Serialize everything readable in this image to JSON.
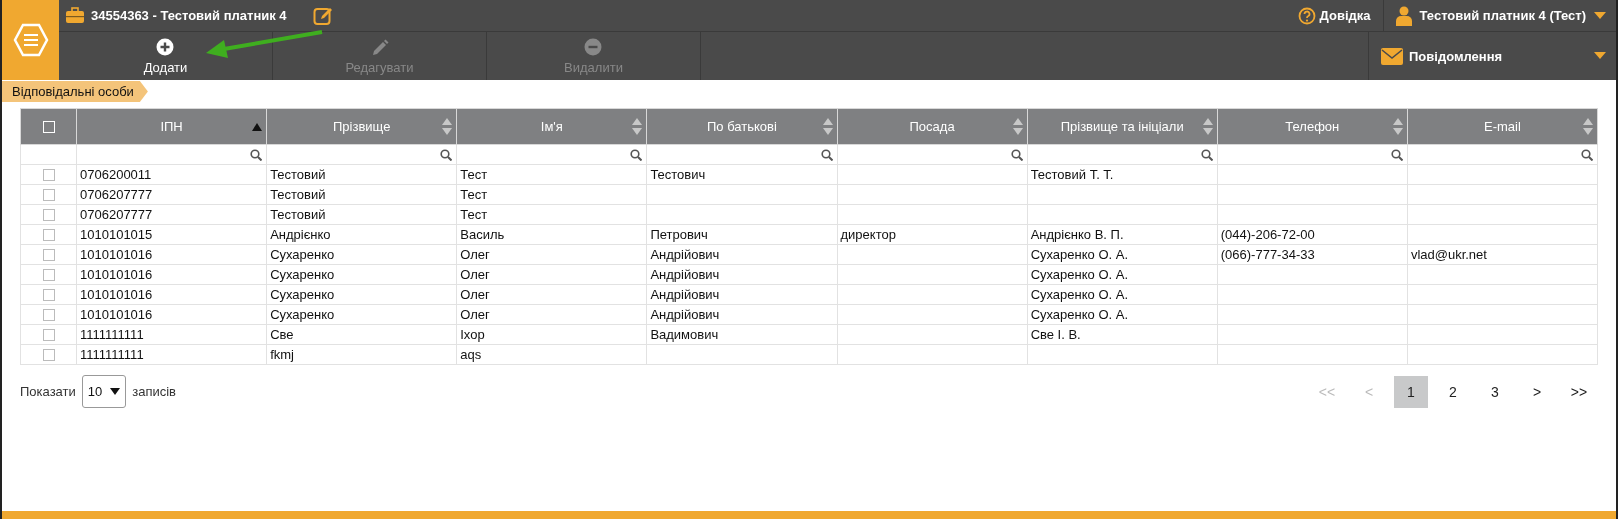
{
  "header": {
    "taxpayer": "34554363 - Тестовий платник 4",
    "help": "Довідка",
    "user": "Тестовий платник 4 (Тест)",
    "messages": "Повідомлення"
  },
  "toolbar": [
    {
      "kind": "add",
      "label": "Додати",
      "disabled": false
    },
    {
      "kind": "edit",
      "label": "Редагувати",
      "disabled": true
    },
    {
      "kind": "delete",
      "label": "Видалити",
      "disabled": true
    }
  ],
  "breadcrumb": "Відповідальні особи",
  "table": {
    "all_checked": false,
    "columns": [
      {
        "label": "ІПН",
        "sorted": true
      },
      {
        "label": "Прізвище",
        "sorted": false
      },
      {
        "label": "Ім'я",
        "sorted": false
      },
      {
        "label": "По батькові",
        "sorted": false
      },
      {
        "label": "Посада",
        "sorted": false
      },
      {
        "label": "Прізвище та ініціали",
        "sorted": false
      },
      {
        "label": "Телефон",
        "sorted": false
      },
      {
        "label": "E-mail",
        "sorted": false
      }
    ],
    "rows": [
      {
        "checked": false,
        "cells": [
          "0706200011",
          "Тестовий",
          "Тест",
          "Тестович",
          "",
          "Тестовий Т. Т.",
          "",
          ""
        ]
      },
      {
        "checked": false,
        "cells": [
          "0706207777",
          "Тестовий",
          "Тест",
          "",
          "",
          "",
          "",
          ""
        ]
      },
      {
        "checked": false,
        "cells": [
          "0706207777",
          "Тестовий",
          "Тест",
          "",
          "",
          "",
          "",
          ""
        ]
      },
      {
        "checked": false,
        "cells": [
          "1010101015",
          "Андрієнко",
          "Василь",
          "Петрович",
          "директор",
          "Андрієнко В. П.",
          "(044)-206-72-00",
          ""
        ]
      },
      {
        "checked": false,
        "cells": [
          "1010101016",
          "Сухаренко",
          "Олег",
          "Андрійович",
          "",
          "Сухаренко О. А.",
          "(066)-777-34-33",
          "vlad@ukr.net"
        ]
      },
      {
        "checked": false,
        "cells": [
          "1010101016",
          "Сухаренко",
          "Олег",
          "Андрійович",
          "",
          "Сухаренко О. А.",
          "",
          ""
        ]
      },
      {
        "checked": false,
        "cells": [
          "1010101016",
          "Сухаренко",
          "Олег",
          "Андрійович",
          "",
          "Сухаренко О. А.",
          "",
          ""
        ]
      },
      {
        "checked": false,
        "cells": [
          "1010101016",
          "Сухаренко",
          "Олег",
          "Андрійович",
          "",
          "Сухаренко О. А.",
          "",
          ""
        ]
      },
      {
        "checked": false,
        "cells": [
          "1111111111",
          "Све",
          "Іхор",
          "Вадимович",
          "",
          "Све І. В.",
          "",
          ""
        ]
      },
      {
        "checked": false,
        "cells": [
          "1111111111",
          "fkmj",
          "aqs",
          "",
          "",
          "",
          "",
          ""
        ]
      }
    ]
  },
  "footer": {
    "show_label": "Показати",
    "page_size": "10",
    "records_label": "записів",
    "pager": [
      {
        "label": "<<",
        "disabled": true,
        "selected": false
      },
      {
        "label": "<",
        "disabled": true,
        "selected": false
      },
      {
        "label": "1",
        "disabled": false,
        "selected": true
      },
      {
        "label": "2",
        "disabled": false,
        "selected": false
      },
      {
        "label": "3",
        "disabled": false,
        "selected": false
      },
      {
        "label": ">",
        "disabled": false,
        "selected": false
      },
      {
        "label": ">>",
        "disabled": false,
        "selected": false
      }
    ]
  }
}
